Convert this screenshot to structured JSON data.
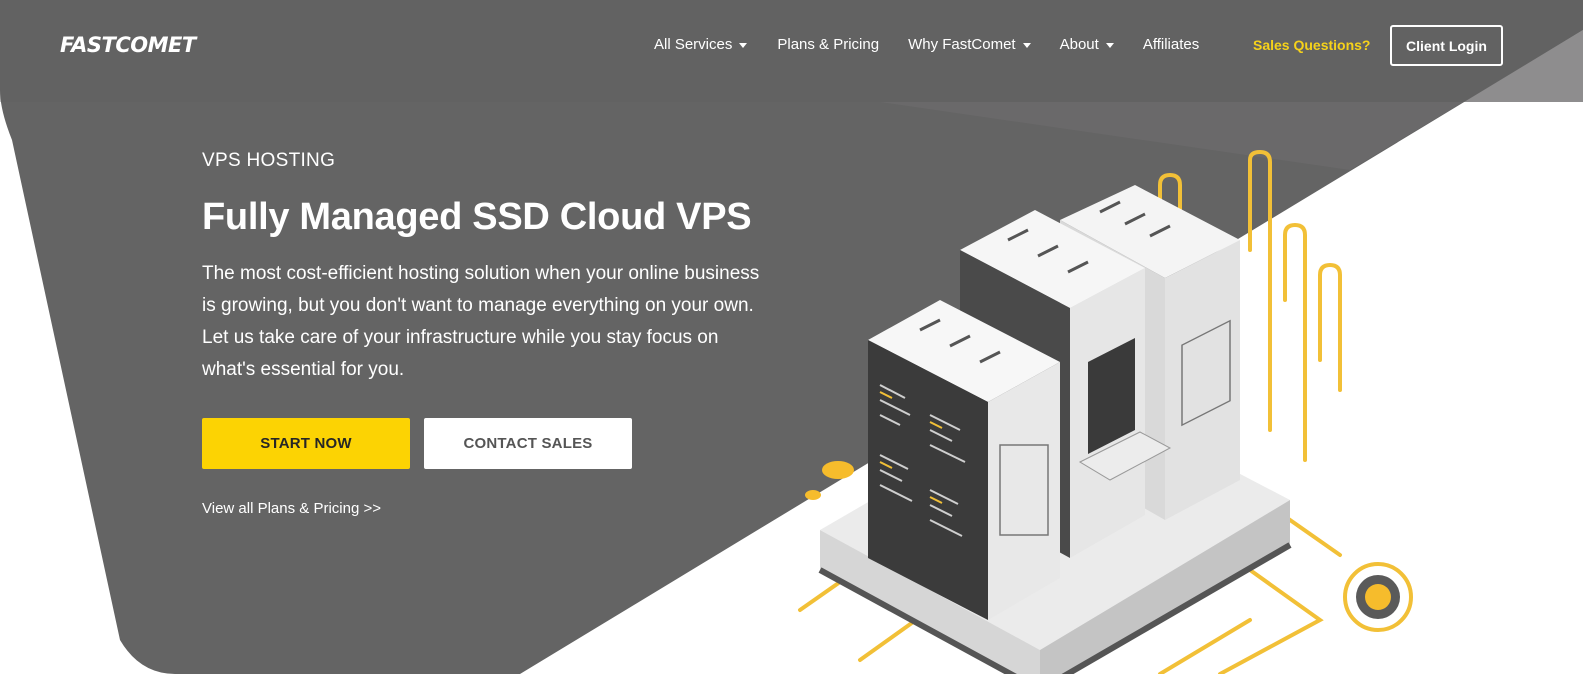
{
  "brand": {
    "logo_text": "FASTCOMET"
  },
  "nav": {
    "items": [
      {
        "label": "All Services",
        "has_dropdown": true
      },
      {
        "label": "Plans & Pricing",
        "has_dropdown": false
      },
      {
        "label": "Why FastComet",
        "has_dropdown": true
      },
      {
        "label": "About",
        "has_dropdown": true
      },
      {
        "label": "Affiliates",
        "has_dropdown": false
      }
    ],
    "sales_questions": "Sales Questions?",
    "client_login": "Client Login"
  },
  "hero": {
    "eyebrow": "VPS HOSTING",
    "title": "Fully Managed SSD Cloud VPS",
    "description": "The most cost-efficient hosting solution when your online business is growing, but you don't want to manage everything on your own. Let us take care of your infrastructure while you stay focus on what's essential for you.",
    "start_now": "START NOW",
    "contact_sales": "CONTACT SALES",
    "plans_link": "View all Plans & Pricing >>"
  },
  "colors": {
    "background_dark": "#646464",
    "accent_yellow": "#fcd303",
    "sales_link": "#f6d21a",
    "white": "#ffffff"
  },
  "icons": {
    "dropdown": "caret-down-icon",
    "illustration": "server-racks-illustration"
  }
}
